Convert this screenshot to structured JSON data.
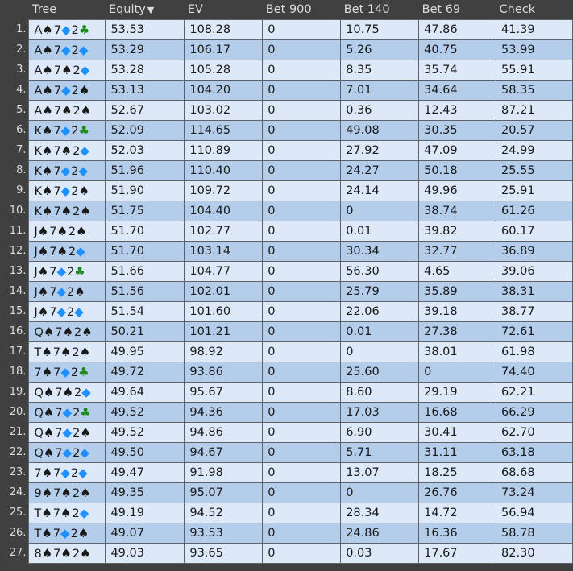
{
  "columns": [
    {
      "key": "tree",
      "label": "Tree"
    },
    {
      "key": "equity",
      "label": "Equity",
      "sort_indicator": "▼"
    },
    {
      "key": "ev",
      "label": "EV"
    },
    {
      "key": "bet900",
      "label": "Bet 900"
    },
    {
      "key": "bet140",
      "label": "Bet 140"
    },
    {
      "key": "bet69",
      "label": "Bet 69"
    },
    {
      "key": "check",
      "label": "Check"
    }
  ],
  "suit_colors": {
    "s": "#1a1a1a",
    "d": "#1e90ff",
    "c": "#1e8a1e"
  },
  "suit_glyphs": {
    "s": "♠",
    "d": "◆",
    "c": "♣"
  },
  "rows": [
    {
      "num": "1.",
      "hand": [
        [
          "A",
          "s"
        ],
        [
          "7",
          "d"
        ],
        [
          "2",
          "c"
        ]
      ],
      "equity": "53.53",
      "ev": "108.28",
      "bet900": "0",
      "bet140": "10.75",
      "bet69": "47.86",
      "check": "41.39"
    },
    {
      "num": "2.",
      "hand": [
        [
          "A",
          "s"
        ],
        [
          "7",
          "d"
        ],
        [
          "2",
          "d"
        ]
      ],
      "equity": "53.29",
      "ev": "106.17",
      "bet900": "0",
      "bet140": "5.26",
      "bet69": "40.75",
      "check": "53.99"
    },
    {
      "num": "3.",
      "hand": [
        [
          "A",
          "s"
        ],
        [
          "7",
          "s"
        ],
        [
          "2",
          "d"
        ]
      ],
      "equity": "53.28",
      "ev": "105.28",
      "bet900": "0",
      "bet140": "8.35",
      "bet69": "35.74",
      "check": "55.91"
    },
    {
      "num": "4.",
      "hand": [
        [
          "A",
          "s"
        ],
        [
          "7",
          "d"
        ],
        [
          "2",
          "s"
        ]
      ],
      "equity": "53.13",
      "ev": "104.20",
      "bet900": "0",
      "bet140": "7.01",
      "bet69": "34.64",
      "check": "58.35"
    },
    {
      "num": "5.",
      "hand": [
        [
          "A",
          "s"
        ],
        [
          "7",
          "s"
        ],
        [
          "2",
          "s"
        ]
      ],
      "equity": "52.67",
      "ev": "103.02",
      "bet900": "0",
      "bet140": "0.36",
      "bet69": "12.43",
      "check": "87.21"
    },
    {
      "num": "6.",
      "hand": [
        [
          "K",
          "s"
        ],
        [
          "7",
          "d"
        ],
        [
          "2",
          "c"
        ]
      ],
      "equity": "52.09",
      "ev": "114.65",
      "bet900": "0",
      "bet140": "49.08",
      "bet69": "30.35",
      "check": "20.57"
    },
    {
      "num": "7.",
      "hand": [
        [
          "K",
          "s"
        ],
        [
          "7",
          "s"
        ],
        [
          "2",
          "d"
        ]
      ],
      "equity": "52.03",
      "ev": "110.89",
      "bet900": "0",
      "bet140": "27.92",
      "bet69": "47.09",
      "check": "24.99"
    },
    {
      "num": "8.",
      "hand": [
        [
          "K",
          "s"
        ],
        [
          "7",
          "d"
        ],
        [
          "2",
          "d"
        ]
      ],
      "equity": "51.96",
      "ev": "110.40",
      "bet900": "0",
      "bet140": "24.27",
      "bet69": "50.18",
      "check": "25.55"
    },
    {
      "num": "9.",
      "hand": [
        [
          "K",
          "s"
        ],
        [
          "7",
          "d"
        ],
        [
          "2",
          "s"
        ]
      ],
      "equity": "51.90",
      "ev": "109.72",
      "bet900": "0",
      "bet140": "24.14",
      "bet69": "49.96",
      "check": "25.91"
    },
    {
      "num": "10.",
      "hand": [
        [
          "K",
          "s"
        ],
        [
          "7",
          "s"
        ],
        [
          "2",
          "s"
        ]
      ],
      "equity": "51.75",
      "ev": "104.40",
      "bet900": "0",
      "bet140": "0",
      "bet69": "38.74",
      "check": "61.26"
    },
    {
      "num": "11.",
      "hand": [
        [
          "J",
          "s"
        ],
        [
          "7",
          "s"
        ],
        [
          "2",
          "s"
        ]
      ],
      "equity": "51.70",
      "ev": "102.77",
      "bet900": "0",
      "bet140": "0.01",
      "bet69": "39.82",
      "check": "60.17"
    },
    {
      "num": "12.",
      "hand": [
        [
          "J",
          "s"
        ],
        [
          "7",
          "s"
        ],
        [
          "2",
          "d"
        ]
      ],
      "equity": "51.70",
      "ev": "103.14",
      "bet900": "0",
      "bet140": "30.34",
      "bet69": "32.77",
      "check": "36.89"
    },
    {
      "num": "13.",
      "hand": [
        [
          "J",
          "s"
        ],
        [
          "7",
          "d"
        ],
        [
          "2",
          "c"
        ]
      ],
      "equity": "51.66",
      "ev": "104.77",
      "bet900": "0",
      "bet140": "56.30",
      "bet69": "4.65",
      "check": "39.06"
    },
    {
      "num": "14.",
      "hand": [
        [
          "J",
          "s"
        ],
        [
          "7",
          "d"
        ],
        [
          "2",
          "s"
        ]
      ],
      "equity": "51.56",
      "ev": "102.01",
      "bet900": "0",
      "bet140": "25.79",
      "bet69": "35.89",
      "check": "38.31"
    },
    {
      "num": "15.",
      "hand": [
        [
          "J",
          "s"
        ],
        [
          "7",
          "d"
        ],
        [
          "2",
          "d"
        ]
      ],
      "equity": "51.54",
      "ev": "101.60",
      "bet900": "0",
      "bet140": "22.06",
      "bet69": "39.18",
      "check": "38.77"
    },
    {
      "num": "16.",
      "hand": [
        [
          "Q",
          "s"
        ],
        [
          "7",
          "s"
        ],
        [
          "2",
          "s"
        ]
      ],
      "equity": "50.21",
      "ev": "101.21",
      "bet900": "0",
      "bet140": "0.01",
      "bet69": "27.38",
      "check": "72.61"
    },
    {
      "num": "17.",
      "hand": [
        [
          "T",
          "s"
        ],
        [
          "7",
          "s"
        ],
        [
          "2",
          "s"
        ]
      ],
      "equity": "49.95",
      "ev": "98.92",
      "bet900": "0",
      "bet140": "0",
      "bet69": "38.01",
      "check": "61.98"
    },
    {
      "num": "18.",
      "hand": [
        [
          "7",
          "s"
        ],
        [
          "7",
          "d"
        ],
        [
          "2",
          "c"
        ]
      ],
      "equity": "49.72",
      "ev": "93.86",
      "bet900": "0",
      "bet140": "25.60",
      "bet69": "0",
      "check": "74.40"
    },
    {
      "num": "19.",
      "hand": [
        [
          "Q",
          "s"
        ],
        [
          "7",
          "s"
        ],
        [
          "2",
          "d"
        ]
      ],
      "equity": "49.64",
      "ev": "95.67",
      "bet900": "0",
      "bet140": "8.60",
      "bet69": "29.19",
      "check": "62.21"
    },
    {
      "num": "20.",
      "hand": [
        [
          "Q",
          "s"
        ],
        [
          "7",
          "d"
        ],
        [
          "2",
          "c"
        ]
      ],
      "equity": "49.52",
      "ev": "94.36",
      "bet900": "0",
      "bet140": "17.03",
      "bet69": "16.68",
      "check": "66.29"
    },
    {
      "num": "21.",
      "hand": [
        [
          "Q",
          "s"
        ],
        [
          "7",
          "d"
        ],
        [
          "2",
          "s"
        ]
      ],
      "equity": "49.52",
      "ev": "94.86",
      "bet900": "0",
      "bet140": "6.90",
      "bet69": "30.41",
      "check": "62.70"
    },
    {
      "num": "22.",
      "hand": [
        [
          "Q",
          "s"
        ],
        [
          "7",
          "d"
        ],
        [
          "2",
          "d"
        ]
      ],
      "equity": "49.50",
      "ev": "94.67",
      "bet900": "0",
      "bet140": "5.71",
      "bet69": "31.11",
      "check": "63.18"
    },
    {
      "num": "23.",
      "hand": [
        [
          "7",
          "s"
        ],
        [
          "7",
          "d"
        ],
        [
          "2",
          "d"
        ]
      ],
      "equity": "49.47",
      "ev": "91.98",
      "bet900": "0",
      "bet140": "13.07",
      "bet69": "18.25",
      "check": "68.68"
    },
    {
      "num": "24.",
      "hand": [
        [
          "9",
          "s"
        ],
        [
          "7",
          "s"
        ],
        [
          "2",
          "s"
        ]
      ],
      "equity": "49.35",
      "ev": "95.07",
      "bet900": "0",
      "bet140": "0",
      "bet69": "26.76",
      "check": "73.24"
    },
    {
      "num": "25.",
      "hand": [
        [
          "T",
          "s"
        ],
        [
          "7",
          "s"
        ],
        [
          "2",
          "d"
        ]
      ],
      "equity": "49.19",
      "ev": "94.52",
      "bet900": "0",
      "bet140": "28.34",
      "bet69": "14.72",
      "check": "56.94"
    },
    {
      "num": "26.",
      "hand": [
        [
          "T",
          "s"
        ],
        [
          "7",
          "d"
        ],
        [
          "2",
          "s"
        ]
      ],
      "equity": "49.07",
      "ev": "93.53",
      "bet900": "0",
      "bet140": "24.86",
      "bet69": "16.36",
      "check": "58.78"
    },
    {
      "num": "27.",
      "hand": [
        [
          "8",
          "s"
        ],
        [
          "7",
          "s"
        ],
        [
          "2",
          "s"
        ]
      ],
      "equity": "49.03",
      "ev": "93.65",
      "bet900": "0",
      "bet140": "0.03",
      "bet69": "17.67",
      "check": "82.30"
    }
  ]
}
